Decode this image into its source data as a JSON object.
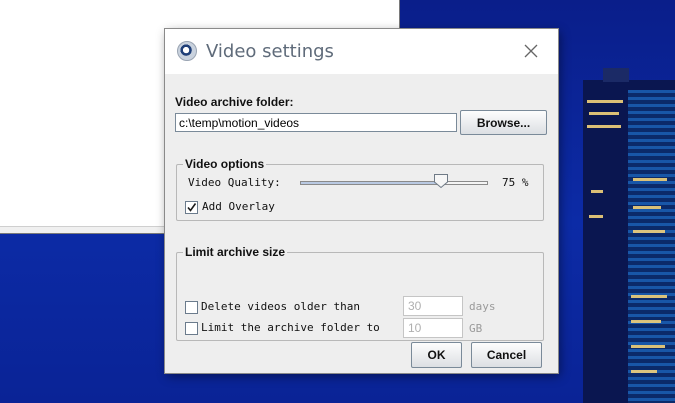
{
  "dialog": {
    "title": "Video settings",
    "icon": "webcam-icon"
  },
  "archive": {
    "label": "Video archive folder:",
    "folder_value": "c:\\temp\\motion_videos",
    "browse_label": "Browse..."
  },
  "video_options": {
    "group_title": "Video options",
    "quality_label": "Video Quality:",
    "quality_value": 75,
    "quality_unit": "%",
    "quality_display": "75 %",
    "overlay_label": "Add Overlay",
    "overlay_checked": true
  },
  "limit": {
    "group_title": "Limit archive size",
    "delete_label": "Delete videos older than",
    "delete_checked": false,
    "delete_value": "30",
    "delete_unit": "days",
    "limit_label": "Limit the archive folder to",
    "limit_checked": false,
    "limit_value": "10",
    "limit_unit": "GB"
  },
  "buttons": {
    "ok_label": "OK",
    "cancel_label": "Cancel"
  },
  "colors": {
    "desktop": "#0b2a9c",
    "dialog_bg": "#eeeeee",
    "slider_fill": "#b9c9e2"
  }
}
